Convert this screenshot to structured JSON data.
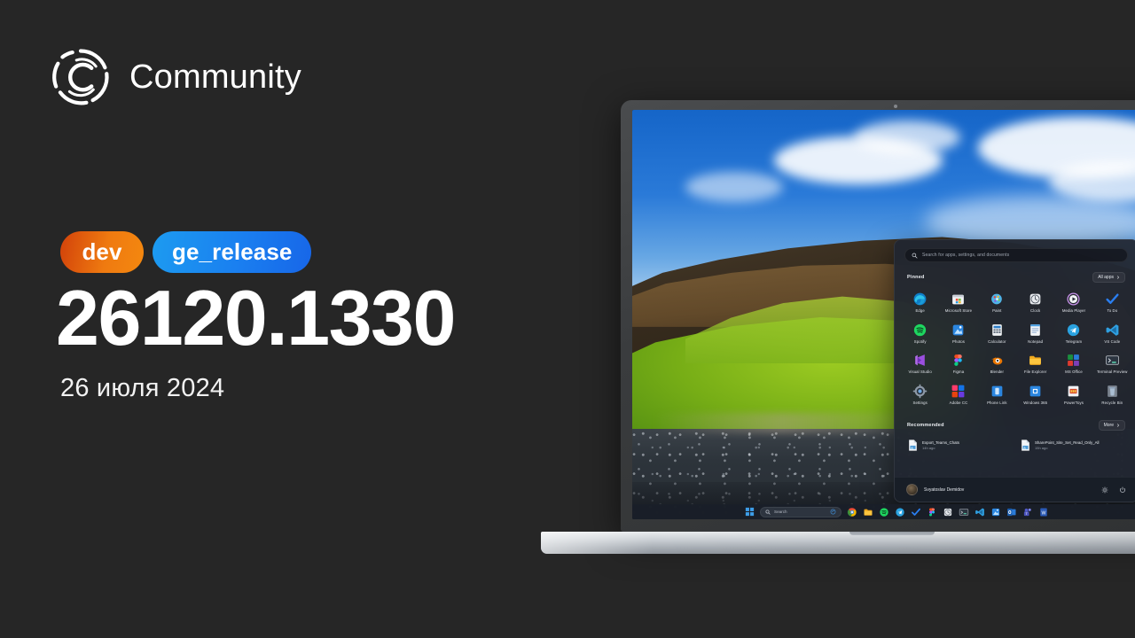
{
  "brand": {
    "name": "Community",
    "logo_icon": "community-circle-c-logo"
  },
  "release": {
    "badges": [
      {
        "label": "dev",
        "color": "#ef7a10"
      },
      {
        "label": "ge_release",
        "color": "#1a7ff0"
      }
    ],
    "build_number": "26120.1330",
    "date": "26 июля 2024"
  },
  "device": {
    "type": "laptop",
    "camera_icon": "webcam-dot"
  },
  "start_menu": {
    "search": {
      "placeholder": "Search for apps, settings, and documents",
      "icon": "search-icon"
    },
    "pinned": {
      "title": "Pinned",
      "all_apps_label": "All apps",
      "chevron_icon": "chevron-right-icon",
      "apps": [
        {
          "label": "Edge",
          "icon": "edge-icon"
        },
        {
          "label": "Microsoft Store",
          "icon": "microsoft-store-icon"
        },
        {
          "label": "Paint",
          "icon": "paint-icon"
        },
        {
          "label": "Clock",
          "icon": "clock-icon"
        },
        {
          "label": "Media Player",
          "icon": "media-player-icon"
        },
        {
          "label": "To Do",
          "icon": "to-do-icon"
        },
        {
          "label": "Spotify",
          "icon": "spotify-icon"
        },
        {
          "label": "Photos",
          "icon": "photos-icon"
        },
        {
          "label": "Calculator",
          "icon": "calculator-icon"
        },
        {
          "label": "Notepad",
          "icon": "notepad-icon"
        },
        {
          "label": "Telegram",
          "icon": "telegram-icon"
        },
        {
          "label": "VS Code",
          "icon": "vs-code-icon"
        },
        {
          "label": "Visual Studio",
          "icon": "visual-studio-icon"
        },
        {
          "label": "Figma",
          "icon": "figma-icon"
        },
        {
          "label": "Blender",
          "icon": "blender-icon"
        },
        {
          "label": "File Explorer",
          "icon": "file-explorer-icon"
        },
        {
          "label": "MS Office",
          "icon": "ms-office-icon"
        },
        {
          "label": "Terminal Preview",
          "icon": "terminal-preview-icon"
        },
        {
          "label": "Settings",
          "icon": "settings-gear-icon"
        },
        {
          "label": "Adobe CC",
          "icon": "adobe-cc-icon"
        },
        {
          "label": "Phone Link",
          "icon": "phone-link-icon"
        },
        {
          "label": "Windows 365",
          "icon": "windows-365-icon"
        },
        {
          "label": "PowerToys",
          "icon": "powertoys-icon"
        },
        {
          "label": "Recycle Bin",
          "icon": "recycle-bin-icon"
        }
      ]
    },
    "recommended": {
      "title": "Recommended",
      "more_label": "More",
      "chevron_icon": "chevron-right-icon",
      "items": [
        {
          "name": "Export_Teams_Chats",
          "time": "14h ago",
          "icon": "document-icon"
        },
        {
          "name": "SharePoint_Site_Set_Read_Only_All",
          "time": "15h ago",
          "icon": "document-icon"
        }
      ]
    },
    "footer": {
      "user_name": "Svyatoslav Demidov",
      "avatar_icon": "user-avatar",
      "settings_icon": "gear-icon",
      "power_icon": "power-icon"
    }
  },
  "taskbar": {
    "start_icon": "windows-start-icon",
    "search": {
      "label": "Search",
      "icon": "search-icon",
      "copilot_icon": "copilot-icon"
    },
    "apps": [
      {
        "icon": "chrome-icon"
      },
      {
        "icon": "file-explorer-icon"
      },
      {
        "icon": "spotify-icon"
      },
      {
        "icon": "telegram-icon"
      },
      {
        "icon": "to-do-icon"
      },
      {
        "icon": "figma-icon"
      },
      {
        "icon": "clock-icon"
      },
      {
        "icon": "terminal-icon"
      },
      {
        "icon": "vs-code-icon"
      },
      {
        "icon": "photos-icon"
      },
      {
        "icon": "outlook-icon"
      },
      {
        "icon": "teams-icon"
      },
      {
        "icon": "word-icon"
      }
    ]
  }
}
